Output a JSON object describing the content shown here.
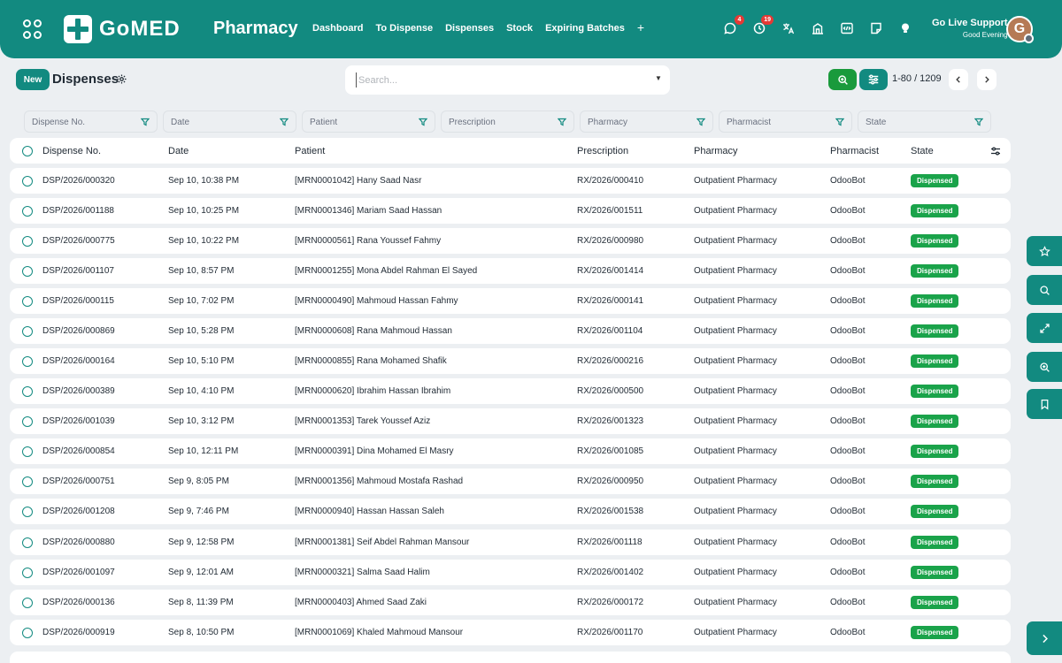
{
  "header": {
    "logo_text": "GoMED",
    "app_title": "Pharmacy",
    "nav": [
      "Dashboard",
      "To Dispense",
      "Dispenses",
      "Stock",
      "Expiring Batches"
    ],
    "nav_add": "+",
    "messages_count": "4",
    "activities_count": "19",
    "support_title": "Go Live Support",
    "support_greeting": "Good Evening",
    "avatar_letter": "G"
  },
  "control": {
    "new_label": "New",
    "title": "Dispenses",
    "search_placeholder": "Search...",
    "pager": "1-80 / 1209"
  },
  "filters": [
    "Dispense No.",
    "Date",
    "Patient",
    "Prescription",
    "Pharmacy",
    "Pharmacist",
    "State"
  ],
  "columns": {
    "dispense": "Dispense No.",
    "date": "Date",
    "patient": "Patient",
    "rx": "Prescription",
    "pharmacy": "Pharmacy",
    "pharmacist": "Pharmacist",
    "state": "State"
  },
  "rows": [
    {
      "dispense": "DSP/2026/000320",
      "date": "Sep 10, 10:38 PM",
      "patient": "[MRN0001042] Hany Saad Nasr",
      "rx": "RX/2026/000410",
      "pharmacy": "Outpatient Pharmacy",
      "pharmacist": "OdooBot",
      "state": "Dispensed"
    },
    {
      "dispense": "DSP/2026/001188",
      "date": "Sep 10, 10:25 PM",
      "patient": "[MRN0001346] Mariam Saad Hassan",
      "rx": "RX/2026/001511",
      "pharmacy": "Outpatient Pharmacy",
      "pharmacist": "OdooBot",
      "state": "Dispensed"
    },
    {
      "dispense": "DSP/2026/000775",
      "date": "Sep 10, 10:22 PM",
      "patient": "[MRN0000561] Rana Youssef Fahmy",
      "rx": "RX/2026/000980",
      "pharmacy": "Outpatient Pharmacy",
      "pharmacist": "OdooBot",
      "state": "Dispensed"
    },
    {
      "dispense": "DSP/2026/001107",
      "date": "Sep 10, 8:57 PM",
      "patient": "[MRN0001255] Mona Abdel Rahman El Sayed",
      "rx": "RX/2026/001414",
      "pharmacy": "Outpatient Pharmacy",
      "pharmacist": "OdooBot",
      "state": "Dispensed"
    },
    {
      "dispense": "DSP/2026/000115",
      "date": "Sep 10, 7:02 PM",
      "patient": "[MRN0000490] Mahmoud Hassan Fahmy",
      "rx": "RX/2026/000141",
      "pharmacy": "Outpatient Pharmacy",
      "pharmacist": "OdooBot",
      "state": "Dispensed"
    },
    {
      "dispense": "DSP/2026/000869",
      "date": "Sep 10, 5:28 PM",
      "patient": "[MRN0000608] Rana Mahmoud Hassan",
      "rx": "RX/2026/001104",
      "pharmacy": "Outpatient Pharmacy",
      "pharmacist": "OdooBot",
      "state": "Dispensed"
    },
    {
      "dispense": "DSP/2026/000164",
      "date": "Sep 10, 5:10 PM",
      "patient": "[MRN0000855] Rana Mohamed Shafik",
      "rx": "RX/2026/000216",
      "pharmacy": "Outpatient Pharmacy",
      "pharmacist": "OdooBot",
      "state": "Dispensed"
    },
    {
      "dispense": "DSP/2026/000389",
      "date": "Sep 10, 4:10 PM",
      "patient": "[MRN0000620] Ibrahim Hassan Ibrahim",
      "rx": "RX/2026/000500",
      "pharmacy": "Outpatient Pharmacy",
      "pharmacist": "OdooBot",
      "state": "Dispensed"
    },
    {
      "dispense": "DSP/2026/001039",
      "date": "Sep 10, 3:12 PM",
      "patient": "[MRN0001353] Tarek Youssef Aziz",
      "rx": "RX/2026/001323",
      "pharmacy": "Outpatient Pharmacy",
      "pharmacist": "OdooBot",
      "state": "Dispensed"
    },
    {
      "dispense": "DSP/2026/000854",
      "date": "Sep 10, 12:11 PM",
      "patient": "[MRN0000391] Dina Mohamed El Masry",
      "rx": "RX/2026/001085",
      "pharmacy": "Outpatient Pharmacy",
      "pharmacist": "OdooBot",
      "state": "Dispensed"
    },
    {
      "dispense": "DSP/2026/000751",
      "date": "Sep 9, 8:05 PM",
      "patient": "[MRN0001356] Mahmoud Mostafa Rashad",
      "rx": "RX/2026/000950",
      "pharmacy": "Outpatient Pharmacy",
      "pharmacist": "OdooBot",
      "state": "Dispensed"
    },
    {
      "dispense": "DSP/2026/001208",
      "date": "Sep 9, 7:46 PM",
      "patient": "[MRN0000940] Hassan Hassan Saleh",
      "rx": "RX/2026/001538",
      "pharmacy": "Outpatient Pharmacy",
      "pharmacist": "OdooBot",
      "state": "Dispensed"
    },
    {
      "dispense": "DSP/2026/000880",
      "date": "Sep 9, 12:58 PM",
      "patient": "[MRN0001381] Seif Abdel Rahman Mansour",
      "rx": "RX/2026/001118",
      "pharmacy": "Outpatient Pharmacy",
      "pharmacist": "OdooBot",
      "state": "Dispensed"
    },
    {
      "dispense": "DSP/2026/001097",
      "date": "Sep 9, 12:01 AM",
      "patient": "[MRN0000321] Salma Saad Halim",
      "rx": "RX/2026/001402",
      "pharmacy": "Outpatient Pharmacy",
      "pharmacist": "OdooBot",
      "state": "Dispensed"
    },
    {
      "dispense": "DSP/2026/000136",
      "date": "Sep 8, 11:39 PM",
      "patient": "[MRN0000403] Ahmed Saad Zaki",
      "rx": "RX/2026/000172",
      "pharmacy": "Outpatient Pharmacy",
      "pharmacist": "OdooBot",
      "state": "Dispensed"
    },
    {
      "dispense": "DSP/2026/000919",
      "date": "Sep 8, 10:50 PM",
      "patient": "[MRN0001069] Khaled Mahmoud Mansour",
      "rx": "RX/2026/001170",
      "pharmacy": "Outpatient Pharmacy",
      "pharmacist": "OdooBot",
      "state": "Dispensed"
    }
  ],
  "side_panel": [
    "star-icon",
    "search-icon",
    "expand-icon",
    "zoom-icon",
    "bookmark-icon",
    "chevron-right-icon"
  ],
  "colors": {
    "brand": "#128a80",
    "state_dispensed": "#1aa34a",
    "search_button": "#1a9a3c"
  }
}
